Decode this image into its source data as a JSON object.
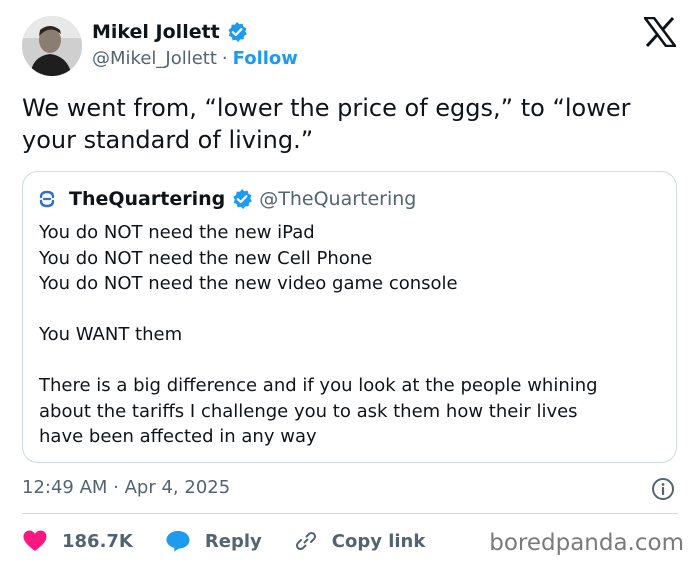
{
  "author": {
    "name": "Mikel Jollett",
    "handle": "@Mikel_Jollett",
    "separator": "·",
    "follow_label": "Follow",
    "avatar_icon": "profile-photo"
  },
  "tweet": {
    "lines": [
      "We went from, “lower the price of eggs,” to “lower",
      "your standard of living.”"
    ]
  },
  "quote": {
    "name": "TheQuartering",
    "handle": "@TheQuartering",
    "lines_a": [
      "You do NOT need the new iPad",
      "You do NOT need the new Cell Phone",
      "You do NOT need the new video game console"
    ],
    "line_b": "You WANT them",
    "lines_c": [
      "There is a big difference and if you look at the people whining",
      "about the tariffs I challenge you to ask them how their lives",
      "have been affected in any way"
    ]
  },
  "meta": {
    "timestamp": "12:49 AM · Apr 4, 2025"
  },
  "actions": {
    "likes": "186.7K",
    "reply_label": "Reply",
    "copy_link_label": "Copy link"
  },
  "watermark": "boredpanda.com",
  "colors": {
    "accent": "#1d9bf0",
    "like": "#f91880",
    "muted": "#536471",
    "text": "#0f1419",
    "border": "#cfd9de"
  }
}
